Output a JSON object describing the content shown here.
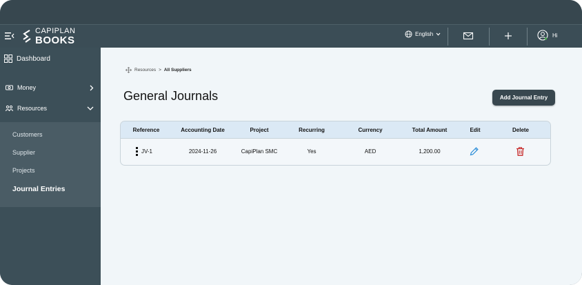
{
  "header": {
    "logo_top": "CAPIPLAN",
    "logo_bottom": "BOOKS",
    "language": "English",
    "greeting": "Hi",
    "icons": [
      "menu-icon",
      "globe-icon",
      "mail-icon",
      "plus-icon",
      "user-icon"
    ]
  },
  "sidebar": {
    "dashboard": "Dashboard",
    "money": "Money",
    "resources": "Resources",
    "sub_items": [
      "Customers",
      "Supplier",
      "Projects",
      "Journal Entries"
    ],
    "active": "Journal Entries"
  },
  "breadcrumb": {
    "parent": "Resources",
    "separator": ">",
    "current": "All Suppliers"
  },
  "page": {
    "title": "General Journals",
    "add_button": "Add Journal Entry"
  },
  "table": {
    "columns": [
      "Reference",
      "Accounting Date",
      "Project",
      "Recurring",
      "Currency",
      "Total Amount",
      "Edit",
      "Delete"
    ],
    "rows": [
      {
        "reference": "JV-1",
        "accounting_date": "2024-11-26",
        "project": "CapiPlan SMC",
        "recurring": "Yes",
        "currency": "AED",
        "total_amount": "1,200.00"
      }
    ]
  },
  "colors": {
    "sidebar": "#3c4f58",
    "header": "#3b4d56",
    "main_bg": "#f1f6f9",
    "table_header": "#dbe9f5",
    "edit_icon": "#2f8fd8",
    "delete_icon": "#c62828",
    "button": "#38474f"
  }
}
